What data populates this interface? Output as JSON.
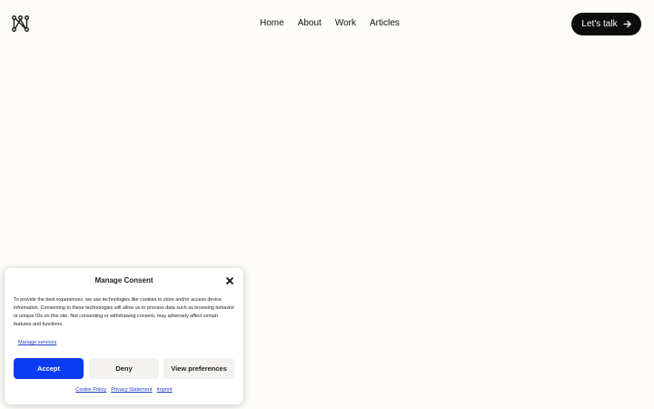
{
  "header": {
    "logo_icon": "network-knot-logo",
    "nav": [
      {
        "label": "Home"
      },
      {
        "label": "About"
      },
      {
        "label": "Work"
      },
      {
        "label": "Articles"
      }
    ],
    "cta_label": "Let's talk",
    "cta_icon": "arrow-right-icon"
  },
  "consent": {
    "title": "Manage Consent",
    "message": "To provide the best experiences, we use technologies like cookies to store and/or access device information. Consenting to these technologies will allow us to process data such as browsing behavior or unique IDs on this site. Not consenting or withdrawing consent, may adversely affect certain features and functions.",
    "manage_services": "Manage services",
    "accept": "Accept",
    "deny": "Deny",
    "view_preferences": "View preferences",
    "links": [
      "Cookie Policy",
      "Privacy Statement",
      "Imprint"
    ],
    "accent_color": "#0a3cf5"
  }
}
